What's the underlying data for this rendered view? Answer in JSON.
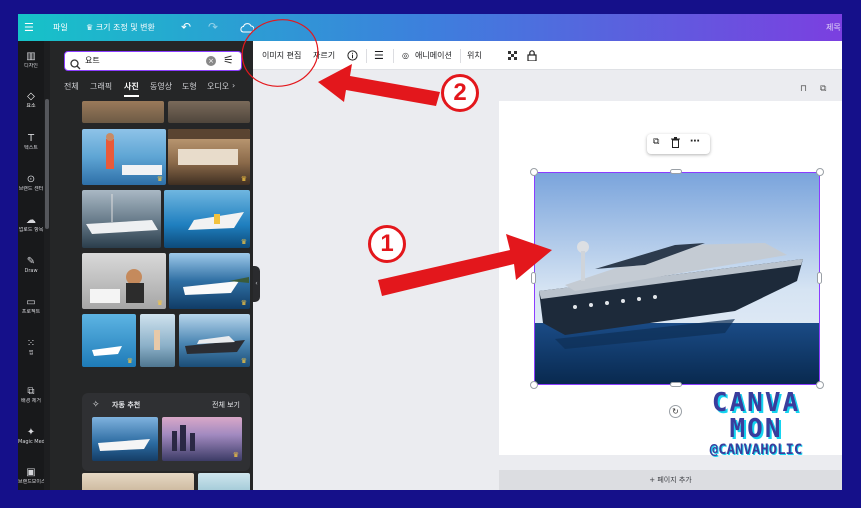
{
  "topbar": {
    "menu_icon": "menu-icon",
    "file_label": "파일",
    "resize_label": "♛ 크기 조정 및 변환",
    "undo_icon": "undo-icon",
    "redo_icon": "redo-icon",
    "cloud_icon": "cloud-sync-icon",
    "right_label": "제목"
  },
  "rail": {
    "items": [
      {
        "label": "디자인",
        "icon": "design-icon"
      },
      {
        "label": "요소",
        "icon": "elements-icon"
      },
      {
        "label": "텍스트",
        "icon": "text-icon"
      },
      {
        "label": "브랜드 센터",
        "icon": "brand-icon"
      },
      {
        "label": "업로드 항목",
        "icon": "upload-icon"
      },
      {
        "label": "Draw",
        "icon": "draw-icon"
      },
      {
        "label": "프로젝트",
        "icon": "folder-icon"
      },
      {
        "label": "앱",
        "icon": "apps-icon"
      },
      {
        "label": "배경 제거",
        "icon": "bg-remove-icon"
      },
      {
        "label": "Magic Media",
        "icon": "magic-media-icon"
      },
      {
        "label": "브랜드보이스",
        "icon": "brand-voice-icon"
      }
    ]
  },
  "panel": {
    "search_value": "요트",
    "tabs": [
      "전체",
      "그래픽",
      "사진",
      "동영상",
      "도형",
      "오디오"
    ],
    "active_tab": "사진",
    "auto_title": "자동 추천",
    "auto_see_all": "전체 보기"
  },
  "toolbar": {
    "edit_image": "이미지 편집",
    "crop": "자르기",
    "animate": "애니메이션",
    "position": "위치"
  },
  "canvas": {
    "add_page": "+ 페이지 추가",
    "watermark_line1": "CANVA",
    "watermark_line2": "MON",
    "watermark_line3": "@CANVAHOLIC"
  },
  "annotations": {
    "step1": "1",
    "step2": "2",
    "accent": "#e3171c"
  },
  "colors": {
    "selection": "#8b3dff",
    "panel_bg": "#252627",
    "rail_bg": "#18191b"
  }
}
